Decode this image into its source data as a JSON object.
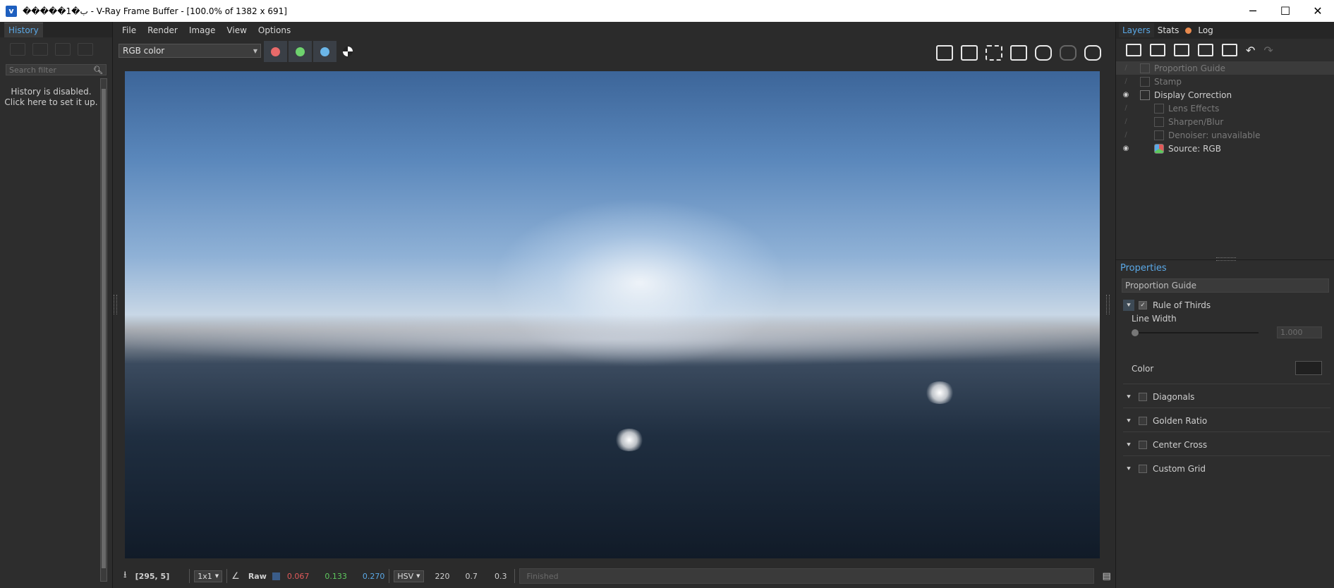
{
  "window": {
    "title": "�����1�ب - V-Ray Frame Buffer - [100.0% of 1382 x 691]",
    "app_icon": "v",
    "minimize": "─",
    "maximize": "☐",
    "close": "✕"
  },
  "history": {
    "tab_label": "History",
    "search_placeholder": "Search filter",
    "message_line1": "History is disabled.",
    "message_line2": "Click here to set it up."
  },
  "menu": {
    "file": "File",
    "render": "Render",
    "image": "Image",
    "view": "View",
    "options": "Options"
  },
  "toolbar": {
    "channel_selected": "RGB color",
    "channel_colors": {
      "red": "#e86a6a",
      "green": "#6ed26e",
      "blue": "#6bb6e8"
    }
  },
  "render_view": {
    "resolution": "1382 x 691"
  },
  "statusbar": {
    "coords": "[295, 5]",
    "zoom_ratio": "1x1",
    "raw_label": "Raw",
    "r_value": "0.067",
    "g_value": "0.133",
    "b_value": "0.270",
    "color_mode": "HSV",
    "h_value": "220",
    "s_value": "0.7",
    "v_value": "0.3",
    "status": "Finished",
    "swatch_color": "#3a5c88"
  },
  "right_panel": {
    "tabs": {
      "layers": "Layers",
      "stats": "Stats",
      "log": "Log"
    },
    "layers": [
      {
        "name": "Proportion Guide",
        "visible": false,
        "selected": true,
        "indent": 0
      },
      {
        "name": "Stamp",
        "visible": false,
        "selected": false,
        "indent": 0
      },
      {
        "name": "Display Correction",
        "visible": true,
        "selected": false,
        "indent": 0
      },
      {
        "name": "Lens Effects",
        "visible": false,
        "selected": false,
        "indent": 1
      },
      {
        "name": "Sharpen/Blur",
        "visible": false,
        "selected": false,
        "indent": 1
      },
      {
        "name": "Denoiser: unavailable",
        "visible": false,
        "selected": false,
        "indent": 1
      },
      {
        "name": "Source: RGB",
        "visible": true,
        "selected": false,
        "indent": 1
      }
    ],
    "properties": {
      "header": "Properties",
      "title": "Proportion Guide",
      "rule_of_thirds": "Rule of Thirds",
      "line_width_label": "Line Width",
      "line_width_value": "1.000",
      "color_label": "Color",
      "diagonals": "Diagonals",
      "golden_ratio": "Golden Ratio",
      "center_cross": "Center Cross",
      "custom_grid": "Custom Grid"
    }
  }
}
